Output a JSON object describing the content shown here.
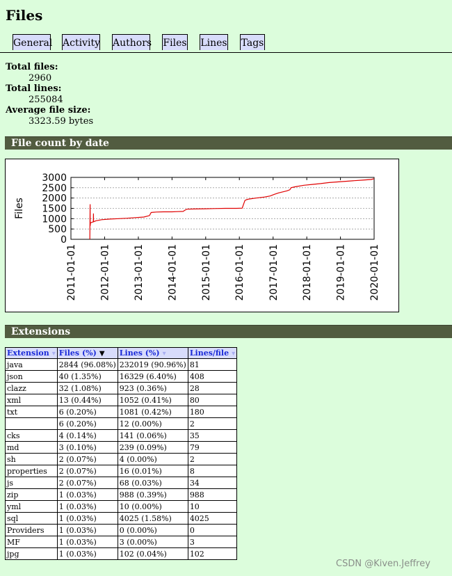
{
  "page": {
    "title": "Files"
  },
  "tabs": [
    {
      "label": "General"
    },
    {
      "label": "Activity"
    },
    {
      "label": "Authors"
    },
    {
      "label": "Files"
    },
    {
      "label": "Lines"
    },
    {
      "label": "Tags"
    }
  ],
  "stats": {
    "total_files_label": "Total files:",
    "total_files": "2960",
    "total_lines_label": "Total lines:",
    "total_lines": "255084",
    "avg_size_label": "Average file size:",
    "avg_size": "3323.59 bytes"
  },
  "sections": {
    "file_count": "File count by date",
    "extensions": "Extensions"
  },
  "chart_data": {
    "type": "line",
    "title": "",
    "ylabel": "Files",
    "xlabel": "",
    "ylim": [
      0,
      3000
    ],
    "yticks": [
      "0",
      "500",
      "1000",
      "1500",
      "2000",
      "2500",
      "3000"
    ],
    "xticks": [
      "2011-01-01",
      "2012-01-01",
      "2013-01-01",
      "2014-01-01",
      "2015-01-01",
      "2016-01-01",
      "2017-01-01",
      "2018-01-01",
      "2019-01-01",
      "2020-01-01"
    ],
    "grid": true,
    "color": "#e00000",
    "series": [
      {
        "x": [
          "2011-07-25",
          "2011-07-28",
          "2011-07-29",
          "2011-08-01",
          "2011-09-01",
          "2011-09-02",
          "2011-09-03",
          "2011-10-01",
          "2011-12-01",
          "2012-03-01",
          "2012-06-01",
          "2012-09-01",
          "2012-12-01",
          "2013-03-01",
          "2013-05-01",
          "2013-05-20",
          "2013-06-15",
          "2013-07-15",
          "2013-10-01",
          "2014-01-01",
          "2014-03-01",
          "2014-05-01",
          "2014-06-01",
          "2014-06-15",
          "2014-09-01",
          "2015-01-01",
          "2015-04-01",
          "2015-08-01",
          "2015-12-01",
          "2016-02-01",
          "2016-03-01",
          "2016-03-20",
          "2016-04-15",
          "2016-07-01",
          "2016-10-01",
          "2016-12-01",
          "2017-01-15",
          "2017-03-01",
          "2017-06-01",
          "2017-07-01",
          "2017-07-15",
          "2017-09-01",
          "2017-12-01",
          "2018-03-01",
          "2018-06-01",
          "2018-09-01",
          "2018-12-01",
          "2019-03-01",
          "2019-06-01",
          "2019-09-01",
          "2019-12-01",
          "2020-01-01"
        ],
        "y": [
          0,
          1700,
          650,
          800,
          850,
          1250,
          850,
          900,
          950,
          980,
          1000,
          1020,
          1050,
          1080,
          1150,
          1300,
          1310,
          1320,
          1330,
          1330,
          1340,
          1350,
          1440,
          1460,
          1470,
          1480,
          1490,
          1500,
          1500,
          1510,
          1880,
          1920,
          1950,
          2000,
          2050,
          2100,
          2180,
          2250,
          2350,
          2400,
          2500,
          2550,
          2620,
          2660,
          2700,
          2750,
          2780,
          2810,
          2840,
          2870,
          2900,
          2940
        ]
      }
    ]
  },
  "table": {
    "headers": [
      "Extension",
      "Files (%)",
      "Lines (%)",
      "Lines/file"
    ],
    "sort_icon": "triangle-down-icon",
    "rows": [
      [
        "java",
        "2844 (96.08%)",
        "232019 (90.96%)",
        "81"
      ],
      [
        "json",
        "40 (1.35%)",
        "16329 (6.40%)",
        "408"
      ],
      [
        "clazz",
        "32 (1.08%)",
        "923 (0.36%)",
        "28"
      ],
      [
        "xml",
        "13 (0.44%)",
        "1052 (0.41%)",
        "80"
      ],
      [
        "txt",
        "6 (0.20%)",
        "1081 (0.42%)",
        "180"
      ],
      [
        "",
        "6 (0.20%)",
        "12 (0.00%)",
        "2"
      ],
      [
        "cks",
        "4 (0.14%)",
        "141 (0.06%)",
        "35"
      ],
      [
        "md",
        "3 (0.10%)",
        "239 (0.09%)",
        "79"
      ],
      [
        "sh",
        "2 (0.07%)",
        "4 (0.00%)",
        "2"
      ],
      [
        "properties",
        "2 (0.07%)",
        "16 (0.01%)",
        "8"
      ],
      [
        "js",
        "2 (0.07%)",
        "68 (0.03%)",
        "34"
      ],
      [
        "zip",
        "1 (0.03%)",
        "988 (0.39%)",
        "988"
      ],
      [
        "yml",
        "1 (0.03%)",
        "10 (0.00%)",
        "10"
      ],
      [
        "sql",
        "1 (0.03%)",
        "4025 (1.58%)",
        "4025"
      ],
      [
        "Providers",
        "1 (0.03%)",
        "0 (0.00%)",
        "0"
      ],
      [
        "MF",
        "1 (0.03%)",
        "3 (0.00%)",
        "3"
      ],
      [
        "jpg",
        "1 (0.03%)",
        "102 (0.04%)",
        "102"
      ]
    ]
  },
  "watermark": "CSDN @Kiven.Jeffrey"
}
